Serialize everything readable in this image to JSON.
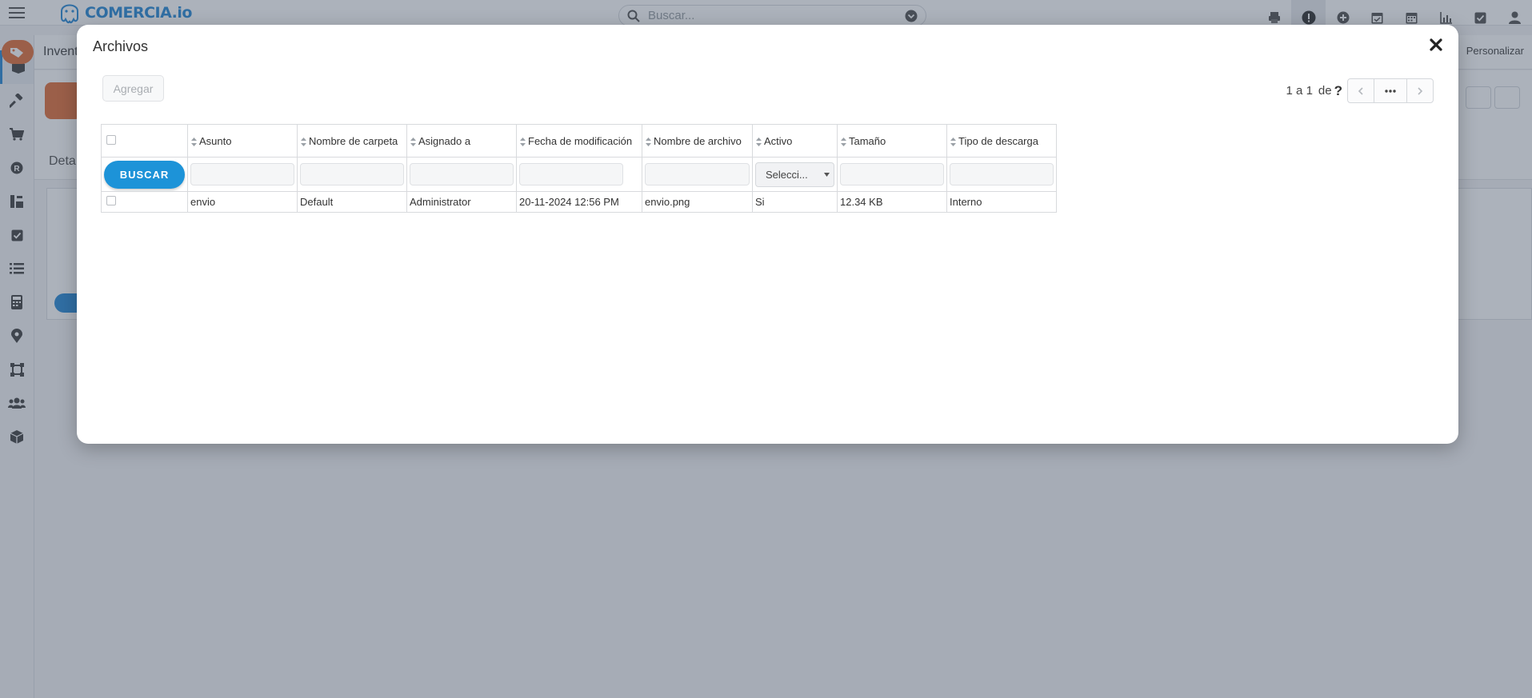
{
  "app": {
    "logo_text": "COMERCIA.io"
  },
  "search": {
    "placeholder": "Buscar..."
  },
  "module": {
    "title": "Invent",
    "personalize_label": "Personalizar",
    "detail_tab": "Deta"
  },
  "modal": {
    "title": "Archivos",
    "add_label": "Agregar",
    "pager": {
      "text": "1 a 1",
      "of": "de",
      "help": "?"
    },
    "search_button": "BUSCAR",
    "columns": [
      "Asunto",
      "Nombre de carpeta",
      "Asignado a",
      "Fecha de modificación",
      "Nombre de archivo",
      "Activo",
      "Tamaño",
      "Tipo de descarga"
    ],
    "active_filter_selected": "Selecci...",
    "rows": [
      {
        "asunto": "envio",
        "carpeta": "Default",
        "asignado": "Administrator",
        "fecha": "20-11-2024 12:56 PM",
        "archivo": "envio.png",
        "activo": "Si",
        "tamano": "12.34 KB",
        "tipo": "Interno"
      }
    ]
  },
  "colors": {
    "accent": "#1d93d8",
    "brand": "#2a8ad6",
    "module_orange": "#e2703c"
  },
  "icons": {
    "topbar": [
      "printer-icon",
      "alert-icon",
      "plus-circle-icon",
      "calendar-check-icon",
      "calendar-icon",
      "chart-icon",
      "checkbox-icon",
      "user-icon"
    ],
    "sidebar": [
      "box-icon",
      "hammer-icon",
      "cart-icon",
      "r-circle-icon",
      "tools-icon",
      "check-square-icon",
      "list-icon",
      "calculator-icon",
      "map-pin-icon",
      "vector-icon",
      "users-icon",
      "cube-icon"
    ]
  }
}
